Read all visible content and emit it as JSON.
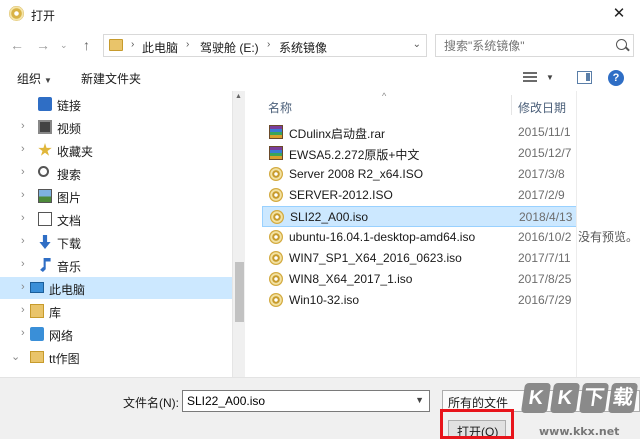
{
  "window": {
    "title": "打开",
    "close_glyph": "✕"
  },
  "nav": {
    "back": "←",
    "forward": "→",
    "recent": "⌄",
    "up": "↑",
    "breadcrumbs": [
      "此电脑",
      "驾驶舱 (E:)",
      "系统镜像"
    ],
    "crumb_sep": "›",
    "refresh": "↻",
    "search_placeholder": "搜索\"系统镜像\""
  },
  "toolbar": {
    "organize": "组织",
    "new_folder": "新建文件夹",
    "help": "?"
  },
  "tree": [
    {
      "label": "链接",
      "icon": "link-icon",
      "chev": ""
    },
    {
      "label": "视频",
      "icon": "video-icon",
      "chev": "›"
    },
    {
      "label": "收藏夹",
      "icon": "star-icon",
      "chev": "›"
    },
    {
      "label": "搜索",
      "icon": "search-icon",
      "chev": "›"
    },
    {
      "label": "图片",
      "icon": "picture-icon",
      "chev": "›"
    },
    {
      "label": "文档",
      "icon": "document-icon",
      "chev": "›"
    },
    {
      "label": "下载",
      "icon": "download-icon",
      "chev": "›"
    },
    {
      "label": "音乐",
      "icon": "music-icon",
      "chev": "›"
    },
    {
      "label": "此电脑",
      "icon": "computer-icon",
      "chev": "›"
    },
    {
      "label": "库",
      "icon": "library-icon",
      "chev": "›"
    },
    {
      "label": "网络",
      "icon": "network-icon",
      "chev": "›"
    },
    {
      "label": "tt作图",
      "icon": "folder-icon",
      "chev": "⌄"
    }
  ],
  "columns": {
    "name": "名称",
    "date": "修改日期",
    "sort_glyph": "^"
  },
  "files": [
    {
      "name": "CDulinx启动盘.rar",
      "date": "2015/11/1",
      "type": "rar"
    },
    {
      "name": "EWSA5.2.272原版+中文",
      "date": "2015/12/7",
      "type": "rar"
    },
    {
      "name": "Server 2008 R2_x64.ISO",
      "date": "2017/3/8",
      "type": "iso"
    },
    {
      "name": "SERVER-2012.ISO",
      "date": "2017/2/9",
      "type": "iso"
    },
    {
      "name": "SLI22_A00.iso",
      "date": "2018/4/13",
      "type": "iso"
    },
    {
      "name": "ubuntu-16.04.1-desktop-amd64.iso",
      "date": "2016/10/2",
      "type": "iso"
    },
    {
      "name": "WIN7_SP1_X64_2016_0623.iso",
      "date": "2017/7/11",
      "type": "iso"
    },
    {
      "name": "WIN8_X64_2017_1.iso",
      "date": "2017/8/25",
      "type": "iso"
    },
    {
      "name": "Win10-32.iso",
      "date": "2016/7/29",
      "type": "iso"
    }
  ],
  "selected_file_index": 4,
  "preview_message": "没有预览。",
  "footer": {
    "filename_label": "文件名(N):",
    "filename_value": "SLI22_A00.iso",
    "filter_label": "所有的文件",
    "open_label": "打开(O)"
  },
  "watermark": {
    "letters": [
      "K",
      "K",
      "下",
      "载"
    ],
    "url": "www.kkx.net"
  },
  "colors": {
    "selection": "#cce8ff",
    "highlight_box": "#e8141b",
    "folder": "#e9c46a"
  }
}
